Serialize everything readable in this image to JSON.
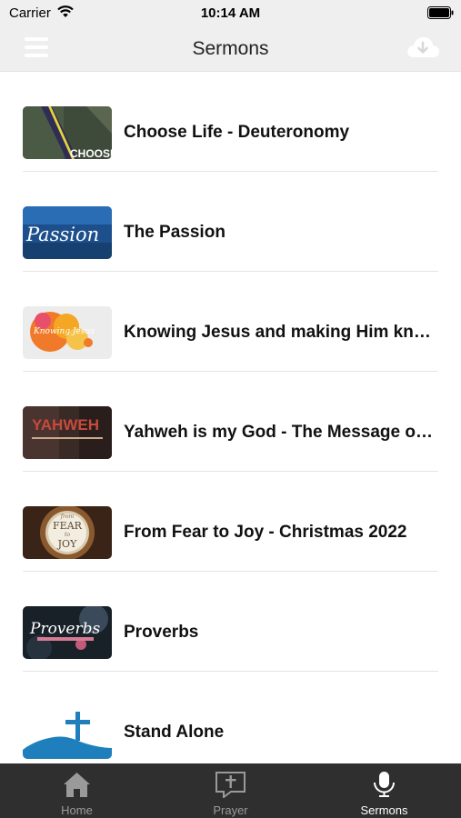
{
  "status_bar": {
    "carrier": "Carrier",
    "time": "10:14 AM",
    "icons": [
      "wifi-icon",
      "battery-icon"
    ]
  },
  "nav": {
    "title": "Sermons",
    "left_icon": "hamburger-menu-icon",
    "right_icon": "cloud-download-icon"
  },
  "sermons": [
    {
      "title": "Choose Life - Deuteronomy",
      "thumb_caption": "CHOOSE"
    },
    {
      "title": "The Passion",
      "thumb_caption": "Passion"
    },
    {
      "title": "Knowing Jesus and making Him kn…",
      "thumb_caption": "Knowing Jesus"
    },
    {
      "title": "Yahweh is my God - The Message o…",
      "thumb_caption": "YAHWEH"
    },
    {
      "title": "From Fear to Joy - Christmas 2022",
      "thumb_caption_1": "from",
      "thumb_caption_2": "FEAR",
      "thumb_caption_3": "to",
      "thumb_caption_4": "JOY"
    },
    {
      "title": "Proverbs",
      "thumb_caption": "Proverbs"
    },
    {
      "title": "Stand Alone"
    }
  ],
  "tabs": [
    {
      "label": "Home",
      "icon": "home-icon",
      "active": false
    },
    {
      "label": "Prayer",
      "icon": "prayer-icon",
      "active": false
    },
    {
      "label": "Sermons",
      "icon": "microphone-icon",
      "active": true
    }
  ],
  "colors": {
    "bar_bg": "#efefef",
    "tab_bg": "#2f2f2f",
    "tab_active": "#ffffff",
    "tab_inactive": "#9a9a9a"
  }
}
